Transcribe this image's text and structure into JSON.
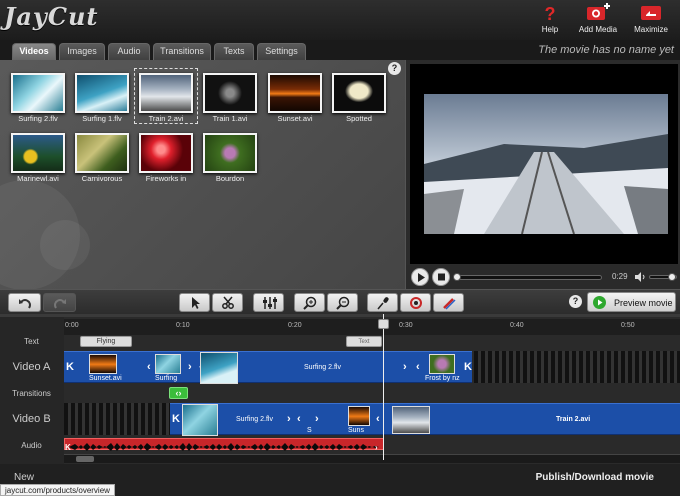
{
  "app": {
    "logo": "JayCut"
  },
  "header": {
    "buttons": [
      {
        "label": "Help",
        "icon": "help-icon"
      },
      {
        "label": "Add Media",
        "icon": "add-media-icon"
      },
      {
        "label": "Maximize",
        "icon": "maximize-icon"
      }
    ]
  },
  "tabs": [
    "Videos",
    "Images",
    "Audio",
    "Transitions",
    "Texts",
    "Settings"
  ],
  "active_tab": "Videos",
  "movie_name": "The movie has no name yet",
  "library": {
    "help": "?",
    "items": [
      {
        "name": "Surfing 2.flv"
      },
      {
        "name": "Surfing 1.flv"
      },
      {
        "name": "Train 2.avi"
      },
      {
        "name": "Train 1.avi"
      },
      {
        "name": "Sunset.avi"
      },
      {
        "name": "Spotted"
      },
      {
        "name": "Marinewl.avi"
      },
      {
        "name": "Carnivorous"
      },
      {
        "name": "Fireworks in"
      },
      {
        "name": "Bourdon"
      }
    ]
  },
  "player": {
    "time": "0:29",
    "progress": 0.0
  },
  "toolbar": {
    "help": "?",
    "preview_label": "Preview movie"
  },
  "timeline": {
    "labels": {
      "text": "Text",
      "video_a": "Video A",
      "transitions": "Transitions",
      "video_b": "Video B",
      "audio": "Audio"
    },
    "ticks": [
      "0:00",
      "0:10",
      "0:20",
      "0:30",
      "0:40",
      "0:50"
    ],
    "text_clips": [
      {
        "label": "Flying"
      },
      {
        "label": "Text"
      }
    ],
    "video_a_clips": [
      "Sunset.avi",
      "Surfing",
      "Surfing 2.flv",
      "Frost by nz"
    ],
    "video_b_clips": [
      "Surfing 2.flv",
      "S",
      "Suns",
      "Train 2.avi"
    ]
  },
  "bottom": {
    "new_label": "New",
    "publish_label": "Publish/Download movie",
    "status_url": "jaycut.com/products/overview"
  },
  "colors": {
    "accent_blue": "#1c4fa8",
    "audio_red": "#c8262a",
    "transition_green": "#3bbd3b",
    "header_red": "#d8262a"
  }
}
